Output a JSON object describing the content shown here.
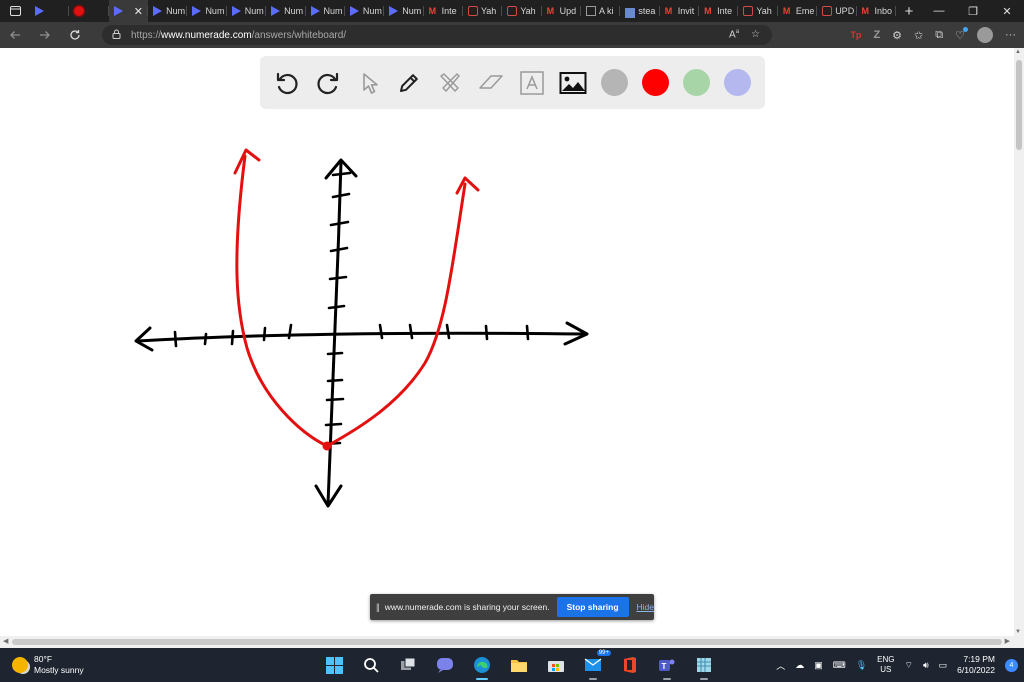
{
  "browser": {
    "tabs": [
      {
        "label": "",
        "icon": "numerade-icon"
      },
      {
        "label": "",
        "icon": "record-icon"
      },
      {
        "label": "",
        "icon": "numerade-icon",
        "active": true
      },
      {
        "label": "Num",
        "icon": "numerade-icon"
      },
      {
        "label": "Num",
        "icon": "numerade-icon"
      },
      {
        "label": "Num",
        "icon": "numerade-icon"
      },
      {
        "label": "Num",
        "icon": "numerade-icon"
      },
      {
        "label": "Num",
        "icon": "numerade-icon"
      },
      {
        "label": "Num",
        "icon": "numerade-icon"
      },
      {
        "label": "Num",
        "icon": "numerade-icon"
      },
      {
        "label": "Inte",
        "icon": "gmail-icon"
      },
      {
        "label": "Yah",
        "icon": "yahoo-icon"
      },
      {
        "label": "Yah",
        "icon": "yahoo-icon"
      },
      {
        "label": "Upd",
        "icon": "gmail-icon"
      },
      {
        "label": "A ki",
        "icon": "document-icon"
      },
      {
        "label": "stea",
        "icon": "steam-icon"
      },
      {
        "label": "Invit",
        "icon": "gmail-icon"
      },
      {
        "label": "Inte",
        "icon": "gmail-icon"
      },
      {
        "label": "Yah",
        "icon": "yahoo-icon"
      },
      {
        "label": "Eme",
        "icon": "gmail-icon"
      },
      {
        "label": "UPD",
        "icon": "yahoo-icon"
      },
      {
        "label": "Inbo",
        "icon": "gmail-icon"
      }
    ],
    "active_tab_close": "✕",
    "new_tab": "+",
    "window_controls": {
      "minimize": "—",
      "restore": "❐",
      "close": "✕"
    },
    "url_prefix": "https://",
    "url_host": "www.numerade.com",
    "url_path": "/answers/whiteboard/"
  },
  "whiteboard": {
    "tools": [
      "undo-icon",
      "redo-icon",
      "select-icon",
      "pen-icon",
      "clear-icon",
      "eraser-icon",
      "text-icon",
      "image-icon"
    ],
    "colors": [
      "#b5b5b5",
      "#ff0000",
      "#a8d5a8",
      "#b4b8ee"
    ],
    "selected_color": "#ff0000"
  },
  "share_banner": {
    "message": "www.numerade.com is sharing your screen.",
    "stop_label": "Stop sharing",
    "hide_label": "Hide"
  },
  "taskbar": {
    "weather_temp": "80°F",
    "weather_desc": "Mostly sunny",
    "pinned": [
      "windows-start-icon",
      "search-icon",
      "task-view-icon",
      "teams-chat-icon",
      "edge-icon",
      "file-explorer-icon",
      "store-icon",
      "mail-icon",
      "office-icon",
      "teams-icon",
      "app-icon"
    ],
    "mail_badge": "99+",
    "language_top": "ENG",
    "language_bottom": "US",
    "time": "7:19 PM",
    "date": "6/10/2022",
    "notifications": "4"
  }
}
